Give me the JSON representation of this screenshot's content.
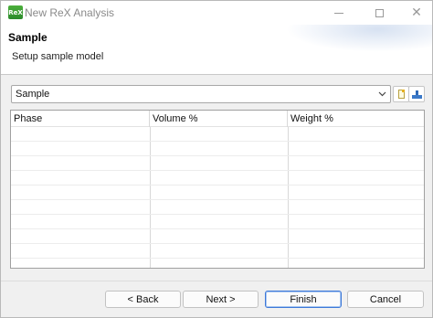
{
  "window": {
    "title": "New ReX Analysis",
    "icon_label": "ReX",
    "controls": [
      "minimize-icon",
      "maximize-icon",
      "close-icon"
    ]
  },
  "header": {
    "title": "Sample",
    "subtitle": "Setup sample model"
  },
  "sample_selector": {
    "value": "Sample",
    "arrow": "chevron-down-icon"
  },
  "toolbar": {
    "new_icon": "new-document-icon",
    "load_icon": "load-icon"
  },
  "table": {
    "columns": [
      "Phase",
      "Volume %",
      "Weight %"
    ],
    "rows": []
  },
  "buttons": {
    "back": "< Back",
    "next": "Next >",
    "finish": "Finish",
    "cancel": "Cancel"
  },
  "colors": {
    "accent": "#3c78d8",
    "app_icon": "#2b8a2b"
  }
}
